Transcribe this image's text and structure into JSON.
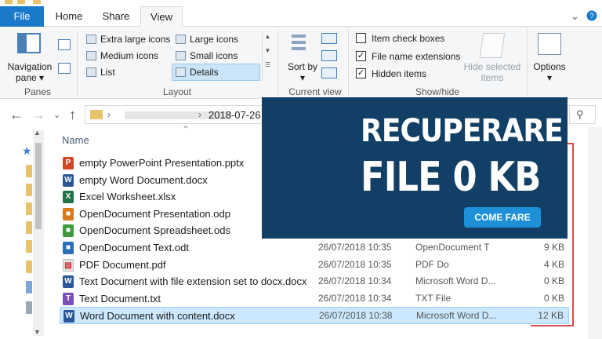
{
  "colors": {
    "accent": "#1979ca",
    "selection": "#cce8ff",
    "banner_bg": "#113f65",
    "banner_button": "#1e90d8",
    "highlight_border": "#e04848"
  },
  "ribbon": {
    "tabs": [
      "File",
      "Home",
      "Share",
      "View"
    ],
    "active_tab": "View",
    "panes": {
      "nav_pane_label": "Navigation pane",
      "group_label": "Panes"
    },
    "layout": {
      "items": [
        "Extra large icons",
        "Large icons",
        "Medium icons",
        "Small icons",
        "List",
        "Details"
      ],
      "selected": "Details",
      "group_label": "Layout"
    },
    "current_view": {
      "sort_label": "Sort by",
      "group_label": "Current view"
    },
    "show_hide": {
      "item_check_boxes": {
        "label": "Item check boxes",
        "checked": false
      },
      "file_name_extensions": {
        "label": "File name extensions",
        "checked": true
      },
      "hidden_items": {
        "label": "Hidden items",
        "checked": true
      },
      "hide_selected_label": "Hide selected items",
      "group_label": "Show/hide"
    },
    "options_label": "Options"
  },
  "address": {
    "folder_name": "2018-07-26 V"
  },
  "list": {
    "column_name": "Name",
    "files": [
      {
        "name": "empty PowerPoint Presentation.pptx",
        "icon": "powerpoint-icon",
        "date": "",
        "type": "",
        "size": ""
      },
      {
        "name": "empty Word Document.docx",
        "icon": "word-icon",
        "date": "",
        "type": "",
        "size": ""
      },
      {
        "name": "Excel Worksheet.xlsx",
        "icon": "excel-icon",
        "date": "",
        "type": "",
        "size": ""
      },
      {
        "name": "OpenDocument Presentation.odp",
        "icon": "odp-icon",
        "date": "",
        "type": "",
        "size": ""
      },
      {
        "name": "OpenDocument Spreadsheet.ods",
        "icon": "ods-icon",
        "date": "",
        "type": "",
        "size": ""
      },
      {
        "name": "OpenDocument Text.odt",
        "icon": "odt-icon",
        "date": "26/07/2018 10:35",
        "type": "OpenDocument T",
        "size": "9 KB"
      },
      {
        "name": "PDF Document.pdf",
        "icon": "pdf-icon",
        "date": "26/07/2018 10:35",
        "type": "PDF Do",
        "size": "4 KB"
      },
      {
        "name": "Text Document with file extension set to docx.docx",
        "icon": "word-icon",
        "date": "26/07/2018 10:34",
        "type": "Microsoft Word D...",
        "size": "0 KB"
      },
      {
        "name": "Text Document.txt",
        "icon": "txt-icon",
        "date": "26/07/2018 10:34",
        "type": "TXT File",
        "size": "0 KB"
      },
      {
        "name": "Word Document with content.docx",
        "icon": "word-icon",
        "date": "26/07/2018 10:38",
        "type": "Microsoft Word D...",
        "size": "12 KB"
      }
    ],
    "selected_file": "Word Document with content.docx"
  },
  "banner": {
    "line1": "RECUPERARE",
    "line2": "FILE 0 KB",
    "button": "COME FARE"
  }
}
